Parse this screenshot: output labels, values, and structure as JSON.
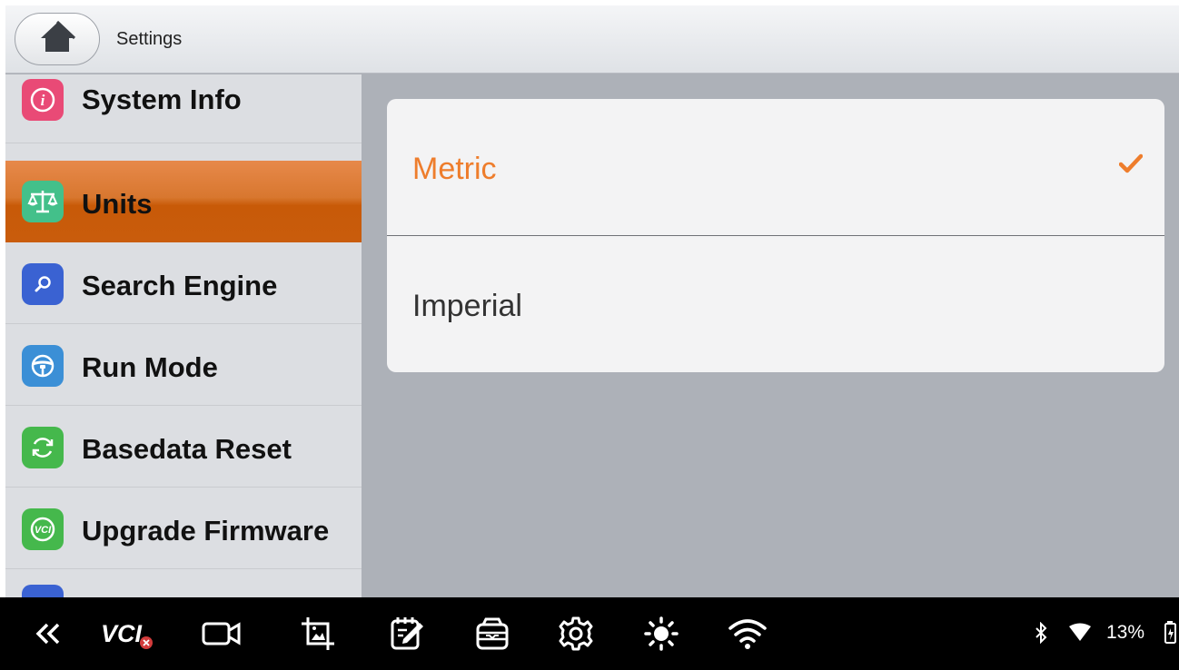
{
  "header": {
    "title": "Settings",
    "home_icon": "home-icon"
  },
  "sidebar": {
    "items": [
      {
        "label": "System Info",
        "icon": "info-icon",
        "color": "#e94a76"
      },
      {
        "label": "Units",
        "icon": "scale-icon",
        "color": "#43c08a",
        "active": true
      },
      {
        "label": "Search Engine",
        "icon": "search-icon",
        "color": "#3a62d2"
      },
      {
        "label": "Run Mode",
        "icon": "steering-wheel-icon",
        "color": "#3b8fd6"
      },
      {
        "label": "Basedata Reset",
        "icon": "refresh-icon",
        "color": "#45b84c"
      },
      {
        "label": "Upgrade Firmware",
        "icon": "vci-icon",
        "color": "#45b84c"
      }
    ],
    "active_color": "#d2691e"
  },
  "units": {
    "options": [
      {
        "label": "Metric",
        "selected": true
      },
      {
        "label": "Imperial",
        "selected": false
      }
    ],
    "selected_color": "#ee7d2c",
    "text_color": "#333333"
  },
  "taskbar": {
    "icons": [
      "back-double-chevron-icon",
      "vci-disconnected-icon",
      "video-camera-icon",
      "screenshot-crop-icon",
      "notes-icon",
      "toolbox-icon",
      "settings-gear-icon",
      "brightness-icon",
      "wifi-icon"
    ],
    "vci_label": "VCI",
    "battery_percent": "13%",
    "status_icons": [
      "bluetooth-icon",
      "wifi-signal-icon",
      "battery-icon"
    ]
  }
}
